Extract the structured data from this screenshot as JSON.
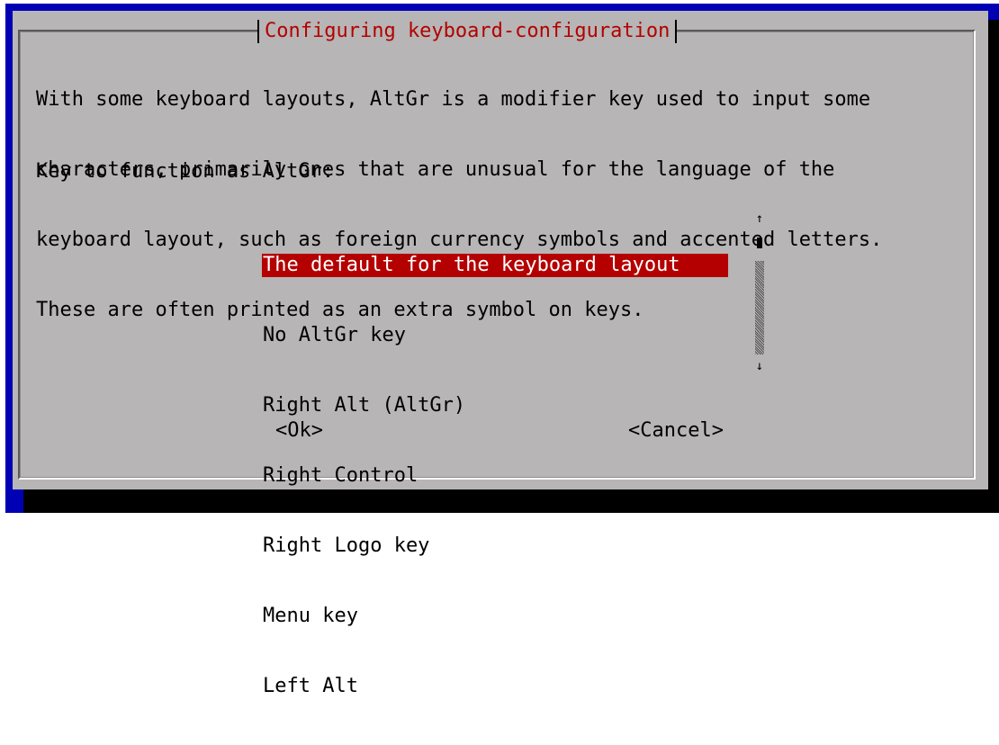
{
  "dialog": {
    "title": "Configuring keyboard-configuration",
    "description_lines": [
      "With some keyboard layouts, AltGr is a modifier key used to input some",
      "characters, primarily ones that are unusual for the language of the",
      "keyboard layout, such as foreign currency symbols and accented letters.",
      "These are often printed as an extra symbol on keys."
    ],
    "prompt": "Key to function as AltGr:",
    "options": [
      "The default for the keyboard layout",
      "No AltGr key",
      "Right Alt (AltGr)",
      "Right Control",
      "Right Logo key",
      "Menu key",
      "Left Alt"
    ],
    "selected_option": "The default for the keyboard layout",
    "scrollbar": {
      "up_arrow": "↑",
      "down_arrow": "↓"
    },
    "ok_label": "<Ok>",
    "cancel_label": "<Cancel>"
  },
  "colors": {
    "screen_background": "#0000b4",
    "dialog_background": "#b7b5b5",
    "title_color": "#b40000",
    "selection_background": "#b40000",
    "selection_text": "#ffffff"
  }
}
